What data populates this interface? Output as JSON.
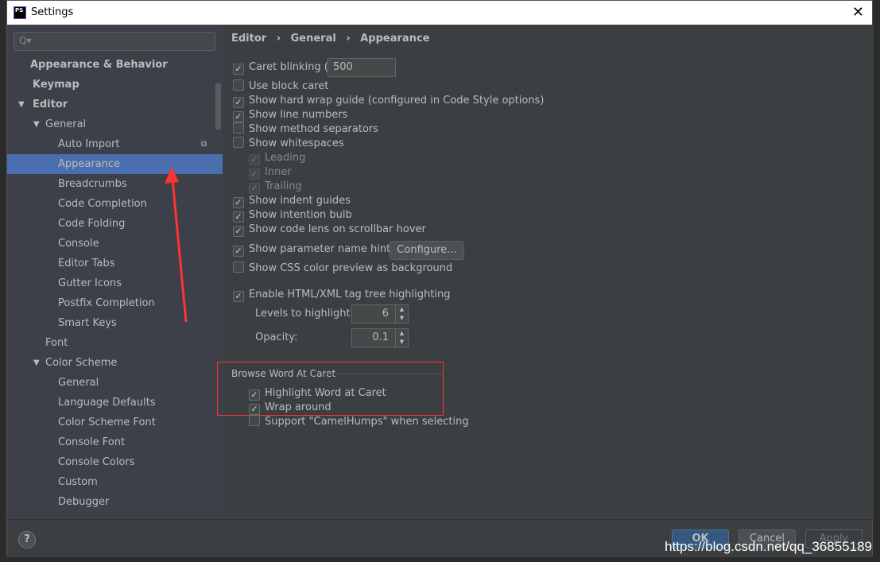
{
  "window": {
    "title": "Settings",
    "app_icon": "PS",
    "close_icon": "✕"
  },
  "search": {
    "placeholder": "Q▾"
  },
  "tree": [
    {
      "label": "Appearance & Behavior",
      "level": 0,
      "bold": true,
      "expand": ""
    },
    {
      "label": "Keymap",
      "level": 0,
      "bold": true,
      "expand": ""
    },
    {
      "label": "Editor",
      "level": 0,
      "bold": true,
      "expand": "▼"
    },
    {
      "label": "General",
      "level": 1,
      "expand": "▼"
    },
    {
      "label": "Auto Import",
      "level": 2,
      "badge": "copy-icon"
    },
    {
      "label": "Appearance",
      "level": 2,
      "selected": true
    },
    {
      "label": "Breadcrumbs",
      "level": 2
    },
    {
      "label": "Code Completion",
      "level": 2
    },
    {
      "label": "Code Folding",
      "level": 2
    },
    {
      "label": "Console",
      "level": 2
    },
    {
      "label": "Editor Tabs",
      "level": 2
    },
    {
      "label": "Gutter Icons",
      "level": 2
    },
    {
      "label": "Postfix Completion",
      "level": 2
    },
    {
      "label": "Smart Keys",
      "level": 2
    },
    {
      "label": "Font",
      "level": 1
    },
    {
      "label": "Color Scheme",
      "level": 1,
      "expand": "▼"
    },
    {
      "label": "General",
      "level": 2
    },
    {
      "label": "Language Defaults",
      "level": 2
    },
    {
      "label": "Color Scheme Font",
      "level": 2
    },
    {
      "label": "Console Font",
      "level": 2
    },
    {
      "label": "Console Colors",
      "level": 2
    },
    {
      "label": "Custom",
      "level": 2
    },
    {
      "label": "Debugger",
      "level": 2
    }
  ],
  "breadcrumb": [
    "Editor",
    "General",
    "Appearance"
  ],
  "breadcrumb_sep": "›",
  "options": [
    {
      "label": "Caret blinking (ms):",
      "checked": true,
      "value": "500"
    },
    {
      "label": "Use block caret",
      "checked": false
    },
    {
      "label": "Show hard wrap guide (configured in Code Style options)",
      "checked": true
    },
    {
      "label": "Show line numbers",
      "checked": true
    },
    {
      "label": "Show method separators",
      "checked": false
    },
    {
      "label": "Show whitespaces",
      "checked": false
    },
    {
      "label": "Leading",
      "checked": true,
      "disabled": true
    },
    {
      "label": "Inner",
      "checked": true,
      "disabled": true
    },
    {
      "label": "Trailing",
      "checked": true,
      "disabled": true
    },
    {
      "label": "Show indent guides",
      "checked": true
    },
    {
      "label": "Show intention bulb",
      "checked": true
    },
    {
      "label": "Show code lens on scrollbar hover",
      "checked": true
    },
    {
      "label": "Show parameter name hints",
      "checked": true,
      "button": "Configure..."
    },
    {
      "label": "Show CSS color preview as background",
      "checked": false
    },
    {
      "label": "Enable HTML/XML tag tree highlighting",
      "checked": true
    }
  ],
  "levels": {
    "label": "Levels to highlight:",
    "value": "6"
  },
  "opacity": {
    "label": "Opacity:",
    "value": "0.1"
  },
  "browse": {
    "title": "Browse Word At Caret",
    "items": [
      {
        "label": "Highlight Word at Caret",
        "checked": true
      },
      {
        "label": "Wrap around",
        "checked": true
      },
      {
        "label": "Support \"CamelHumps\" when selecting",
        "checked": false
      }
    ]
  },
  "footer": {
    "help": "?",
    "ok": "OK",
    "cancel": "Cancel",
    "apply": "Apply"
  },
  "watermark": "https://blog.csdn.net/qq_36855189",
  "colors": {
    "selection": "#4b6eaf",
    "ok": "#365880",
    "annotation": "#ff3333"
  }
}
